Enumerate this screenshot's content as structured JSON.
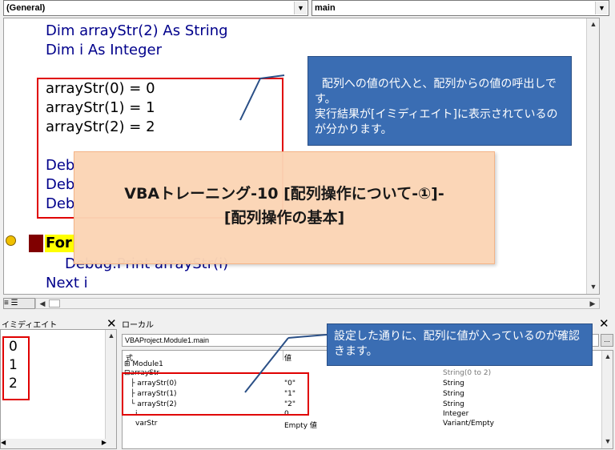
{
  "toolbar": {
    "object_combo": "(General)",
    "proc_combo": "main"
  },
  "code_lines": [
    "Dim arrayStr(2) As String",
    "Dim i As Integer",
    "arrayStr(0) = 0",
    "arrayStr(1) = 1",
    "arrayStr(2) = 2",
    "Deb",
    "Deb",
    "Deb",
    "For",
    "Debug.Print arrayStr(i)",
    "Next i"
  ],
  "callout_top": "配列への値の代入と、配列からの値の呼出しです。\n実行結果が[イミディエイト]に表示されているのが分かります。",
  "banner": {
    "line1": "VBAトレーニング-10 [配列操作について-①]-",
    "line2": "[配列操作の基本]"
  },
  "immediate": {
    "title": "イミディエイト",
    "values": [
      "0",
      "1",
      "2"
    ]
  },
  "locals": {
    "title": "ローカル",
    "context": "VBAProject.Module1.main",
    "headers": {
      "expr": "式",
      "value": "値"
    },
    "rows": [
      {
        "expr": "Module1",
        "value": "",
        "type": ""
      },
      {
        "expr": "arrayStr",
        "value": "",
        "type": "String(0 to 2)"
      },
      {
        "expr": "arrayStr(0)",
        "value": "\"0\"",
        "type": "String"
      },
      {
        "expr": "arrayStr(1)",
        "value": "\"1\"",
        "type": "String"
      },
      {
        "expr": "arrayStr(2)",
        "value": "\"2\"",
        "type": "String"
      },
      {
        "expr": "i",
        "value": "0",
        "type": "Integer"
      },
      {
        "expr": "varStr",
        "value": "Empty 値",
        "type": "Variant/Empty"
      }
    ]
  },
  "callout_bottom": "設定した通りに、配列に値が入っているのが確認きます。",
  "colors": {
    "callout_bg": "#3a6db3",
    "banner_bg": "#fbd5b5",
    "highlight_red": "#e00000",
    "exec_yellow": "#ffff00"
  }
}
